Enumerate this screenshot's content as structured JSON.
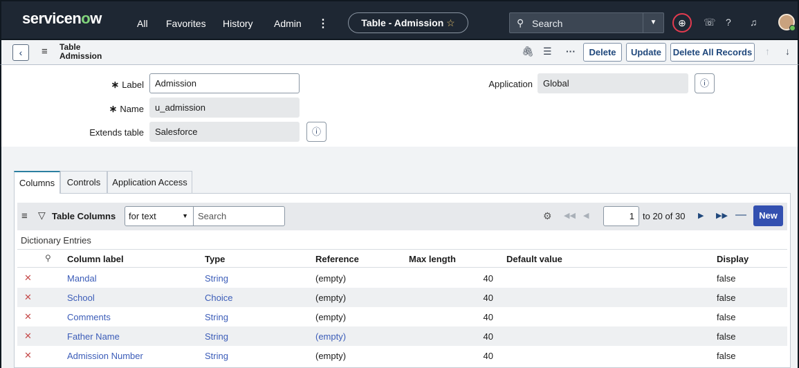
{
  "nav": {
    "logo_pre": "servicen",
    "logo_o": "o",
    "logo_post": "w",
    "links": [
      "All",
      "Favorites",
      "History",
      "Admin"
    ],
    "context": "Table - Admission",
    "search_label": "Search"
  },
  "formbar": {
    "title_line1": "Table",
    "title_line2": "Admission",
    "delete": "Delete",
    "update": "Update",
    "delete_all": "Delete All Records"
  },
  "form": {
    "label_label": "Label",
    "label_value": "Admission",
    "name_label": "Name",
    "name_value": "u_admission",
    "extends_label": "Extends table",
    "extends_value": "Salesforce",
    "application_label": "Application",
    "application_value": "Global"
  },
  "tabs": [
    "Columns",
    "Controls",
    "Application Access"
  ],
  "list": {
    "title": "Table Columns",
    "filter_select": "for text",
    "search_placeholder": "Search",
    "page_value": "1",
    "page_of": "to 20 of 30",
    "new_label": "New",
    "section_label": "Dictionary Entries",
    "columns": [
      "Column label",
      "Type",
      "Reference",
      "Max length",
      "Default value",
      "Display"
    ],
    "rows": [
      {
        "label": "Mandal",
        "type": "String",
        "reference": "(empty)",
        "max_length": "40",
        "default": "",
        "display": "false"
      },
      {
        "label": "School",
        "type": "Choice",
        "reference": "(empty)",
        "max_length": "40",
        "default": "",
        "display": "false"
      },
      {
        "label": "Comments",
        "type": "String",
        "reference": "(empty)",
        "max_length": "40",
        "default": "",
        "display": "false"
      },
      {
        "label": "Father Name",
        "type": "String",
        "reference": "(empty)",
        "max_length": "40",
        "default": "",
        "display": "false"
      },
      {
        "label": "Admission Number",
        "type": "String",
        "reference": "(empty)",
        "max_length": "40",
        "default": "",
        "display": "false"
      }
    ]
  },
  "colors": {
    "nav_bg": "#1e2733",
    "accent": "#3350b0",
    "link": "#3b5cb8",
    "logo_o": "#81d47b"
  }
}
